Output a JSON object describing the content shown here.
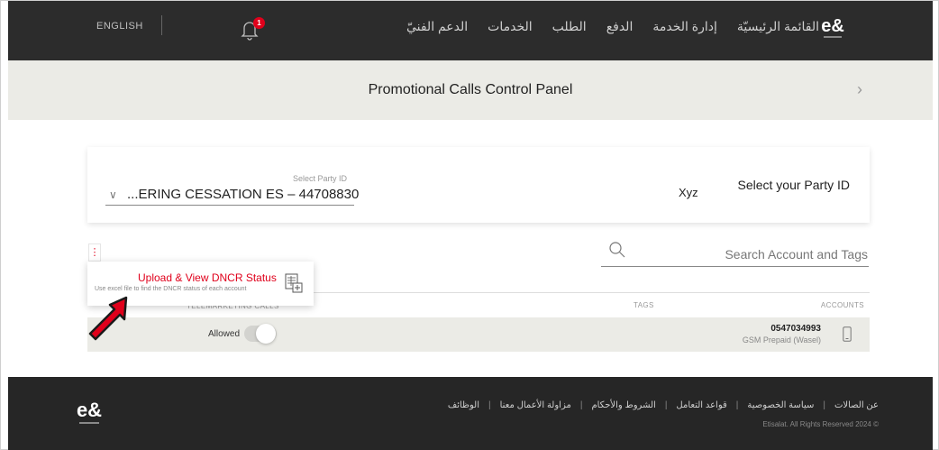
{
  "topnav": {
    "language": "ENGLISH",
    "notification_count": "1",
    "links": [
      "القائمة الرئيسيّة",
      "إدارة الخدمة",
      "الدفع",
      "الطلب",
      "الخدمات",
      "الدعم الفنيّ"
    ],
    "logo_text": "e&"
  },
  "titlebar": {
    "title": "Promotional Calls Control Panel",
    "chevron": "›"
  },
  "party": {
    "field_label": "Select Party ID",
    "field_value": "...ERING CESSATION ES – 44708830",
    "name": "Xyz",
    "heading": "Select your Party ID"
  },
  "search": {
    "placeholder": "Search Account and Tags"
  },
  "kebab": "⋮",
  "popup": {
    "title": "Upload & View DNCR Status",
    "subtitle": "Use excel file to find the DNCR status of each account"
  },
  "table": {
    "headers": {
      "telemarketing": "TELEMARKETING CALLS",
      "tags": "TAGS",
      "accounts": "ACCOUNTS"
    },
    "rows": [
      {
        "status": "Allowed",
        "toggle_on": true,
        "account_number": "0547034993",
        "account_type": "GSM Prepaid (Wasel)"
      }
    ]
  },
  "footer": {
    "links": [
      "عن الصالات",
      "سياسة الخصوصية",
      "قواعد التعامل",
      "الشروط والأحكام",
      "مزاولة الأعمال معنا",
      "الوظائف"
    ],
    "copyright": "Etisalat. All Rights Reserved 2024 ©"
  },
  "colors": {
    "accent": "#e0001b",
    "nav_bg": "#2c2c2c",
    "banner_bg": "#ebebe6",
    "footer_bg": "#262626"
  }
}
